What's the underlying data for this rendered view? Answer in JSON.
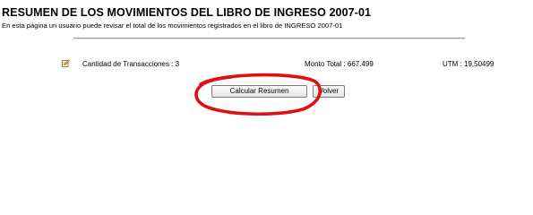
{
  "header": {
    "title": "RESUMEN DE LOS MOVIMIENTOS DEL LIBRO DE INGRESO 2007-01",
    "subtitle": "En esta página un usuario puede revisar el total de los movimientos registrados en el libro de INGRESO 2007-01"
  },
  "summary": {
    "icon": "edit-icon",
    "transacciones": "Cantidad de Transacciones : 3",
    "monto_total": "Monto Total : 667.499",
    "utm": "UTM : 19,50499"
  },
  "actions": {
    "calcular_label": "Calcular Resumen",
    "volver_label": "Volver"
  },
  "colors": {
    "annotation": "#e01010"
  }
}
